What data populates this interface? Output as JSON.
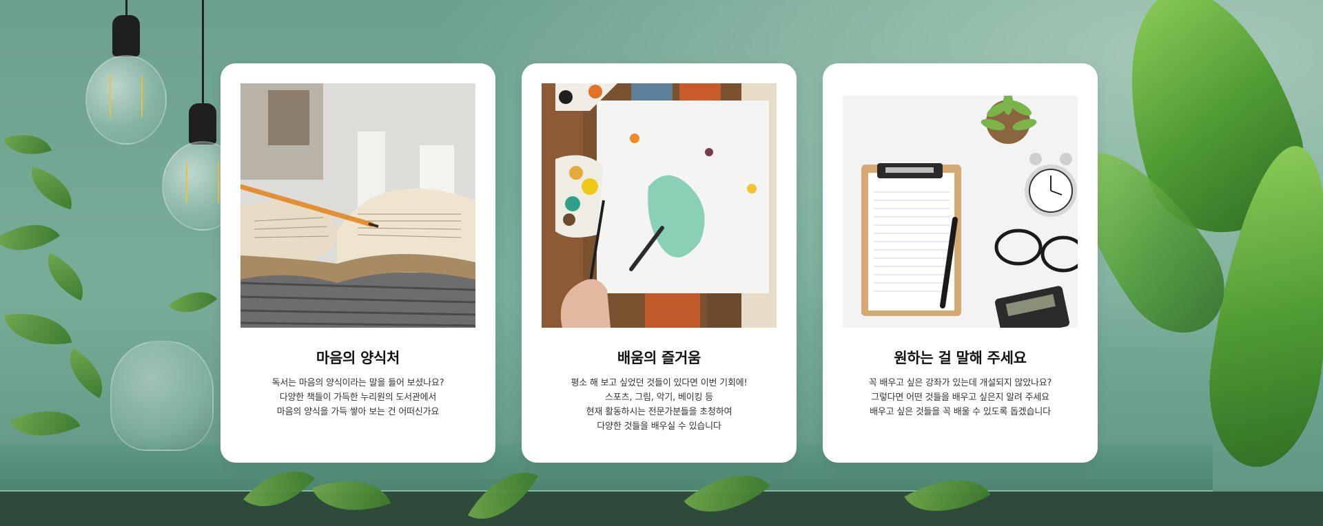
{
  "colors": {
    "background_wall": "#6fa693",
    "card_background": "#ffffff",
    "title_text": "#111111",
    "body_text": "#333333"
  },
  "cards": [
    {
      "title": "마음의 양식처",
      "image": "open-book-with-pencil-photo",
      "lines": [
        "독서는 마음의 양식이라는 말을 들어 보셨나요?",
        "다양한 책들이 가득한 누리원의 도서관에서",
        "마음의 양식을 가득 쌓아 보는 건 어떠신가요"
      ]
    },
    {
      "title": "배움의 즐거움",
      "image": "painting-palette-brush-photo",
      "lines": [
        "평소 해 보고 싶었던 것들이 있다면 이번 기회에!",
        "스포츠, 그림, 악기, 베이킹 등",
        "현재 활동하시는 전문가분들을 초청하여",
        "다양한 것들을 배우실 수 있습니다"
      ]
    },
    {
      "title": "원하는 걸 말해 주세요",
      "image": "clipboard-clock-glasses-photo",
      "lines": [
        "꼭 배우고 싶은 강좌가 있는데 개설되지 않았나요?",
        "그렇다면 어떤 것들을 배우고 싶은지 알려 주세요",
        "배우고 싶은 것들을 꼭 배울 수 있도록 돕겠습니다"
      ]
    }
  ]
}
